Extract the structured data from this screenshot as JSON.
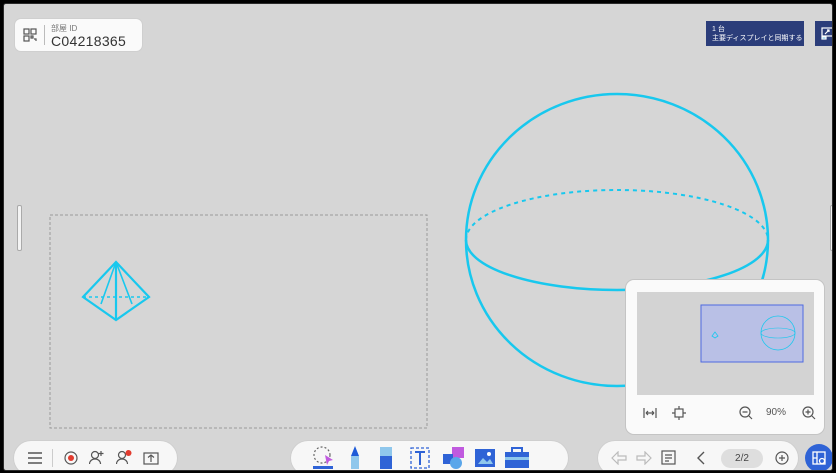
{
  "room": {
    "label": "部屋 ID",
    "id": "C04218365"
  },
  "sync": {
    "count": "1 台",
    "label": "主要ディスプレイと同期する"
  },
  "minimap": {
    "zoom_level": "90%"
  },
  "pagination": {
    "current": "2/2"
  },
  "colors": {
    "drawing_stroke": "#18c8ee",
    "accent": "#2f63d6",
    "sync_bg": "#2b3d7a",
    "notification": "#e23b2e"
  },
  "notification_badge": "1"
}
